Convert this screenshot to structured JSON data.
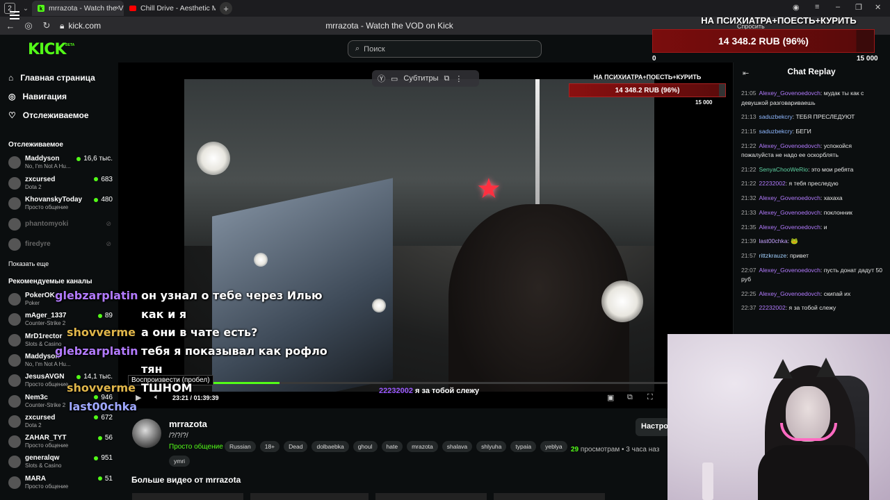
{
  "browser": {
    "tab_count": "2",
    "tabs": [
      {
        "label": "mrrazota - Watch the V",
        "close": "×"
      },
      {
        "label": "Chill Drive - Aesthetic Mus"
      }
    ],
    "new_tab": "+",
    "url": "kick.com",
    "page_title": "mrrazota - Watch the VOD on Kick",
    "window_controls": {
      "minimize": "–",
      "restore": "❐",
      "close": "✕"
    }
  },
  "kick": {
    "logo": "KICK",
    "beta": "BETA",
    "search_placeholder": "Поиск"
  },
  "sidebar": {
    "menu": [
      {
        "label": "Главная страница",
        "icon": "home-icon"
      },
      {
        "label": "Навигация",
        "icon": "compass-icon"
      },
      {
        "label": "Отслеживаемое",
        "icon": "heart-icon"
      }
    ],
    "followed_heading": "Отслеживаемое",
    "followed": [
      {
        "name": "Maddyson",
        "category": "No, I'm Not A Hu...",
        "viewers": "16,6 тыс."
      },
      {
        "name": "zxcursed",
        "category": "Dota 2",
        "viewers": "683"
      },
      {
        "name": "KhovanskyToday",
        "category": "Просто общение",
        "viewers": "480"
      },
      {
        "name": "phantomyoki",
        "offline": true
      },
      {
        "name": "firedyre",
        "offline": true
      }
    ],
    "show_more": "Показать еще",
    "recommended_heading": "Рекомендуемые каналы",
    "recommended": [
      {
        "name": "PokerOK",
        "category": "Poker",
        "viewers": ""
      },
      {
        "name": "mAger_1337",
        "category": "Counter-Strike 2",
        "viewers": "89"
      },
      {
        "name": "MrD1rector",
        "category": "Slots & Casino",
        "viewers": ""
      },
      {
        "name": "Maddyson",
        "category": "No, I'm Not A Hu...",
        "viewers": ""
      },
      {
        "name": "JesusAVGN",
        "category": "Просто общение",
        "viewers": "14,1 тыс."
      },
      {
        "name": "Nem3c",
        "category": "Counter-Strike 2",
        "viewers": "946"
      },
      {
        "name": "zxcursed",
        "category": "Dota 2",
        "viewers": "672"
      },
      {
        "name": "ZAHAR_TYT",
        "category": "Просто общение",
        "viewers": "56"
      },
      {
        "name": "generalqw",
        "category": "Slots & Casino",
        "viewers": "951"
      },
      {
        "name": "MARA",
        "category": "Просто общение",
        "viewers": "51"
      }
    ]
  },
  "player": {
    "subtitles_label": "Субтитры",
    "overlay_title": "НА ПСИХИАТРА+ПОЕСТЬ+КУРИТЬ",
    "overlay_amount": "14 348.2 RUB (96%)",
    "overlay_max": "15 000",
    "progress": 0.28,
    "tooltip": "Воспроизвести (пробел)",
    "time": "23:21 / 01:39:39",
    "chat_user": "22232002",
    "chat_msg": "я за тобой слежу"
  },
  "stream_chat_overlay": [
    {
      "user": "glebzarplatin",
      "msg": "он узнал о тебе через Илью"
    },
    {
      "user": "",
      "msg": "как и я"
    },
    {
      "user": "shovverme",
      "msg": "а они в чате есть?"
    },
    {
      "user": "glebzarplatin",
      "msg": "тебя я показывал как рофло"
    },
    {
      "user": "",
      "msg": "тян"
    },
    {
      "user": "shovverme",
      "msg": "ТШНОМ"
    },
    {
      "user": "last00chka",
      "msg": ""
    }
  ],
  "info": {
    "streamer": "mrrazota",
    "title": "/?/?/?/",
    "category": "Просто общение",
    "tags": [
      "Russian",
      "18+",
      "Dead",
      "dolbaebka",
      "ghoul",
      "hate",
      "mrazota",
      "shalava",
      "shlyuha",
      "typaia",
      "yeblya",
      "ymri"
    ],
    "views_count": "29",
    "views_label": "просмотрам",
    "ago": "• 3 часа наз",
    "settings_btn": "Настро",
    "more_videos": "Больше видео от mrrazota"
  },
  "chat": {
    "title": "Chat Replay",
    "messages": [
      {
        "time": "21:05",
        "user": "Alexey_Govenoedovch",
        "color": "#b37bff",
        "text": "мудак ты как с девушкой разговариваешь"
      },
      {
        "time": "21:13",
        "user": "saduzbekcry",
        "color": "#8fb8ff",
        "text": "ТЕБЯ ПРЕСЛЕДУЮТ"
      },
      {
        "time": "21:15",
        "user": "saduzbekcry",
        "color": "#8fb8ff",
        "text": "БЕГИ"
      },
      {
        "time": "21:22",
        "user": "Alexey_Govenoedovch",
        "color": "#b37bff",
        "text": "успокойся пожалуйста не надо ее оскорблять"
      },
      {
        "time": "21:22",
        "user": "SenyaChooWeRio",
        "color": "#5fd3a3",
        "text": "это мои ребята"
      },
      {
        "time": "21:22",
        "user": "22232002",
        "color": "#b37bff",
        "text": "я тебя преследую"
      },
      {
        "time": "21:32",
        "user": "Alexey_Govenoedovch",
        "color": "#b37bff",
        "text": "хахаха"
      },
      {
        "time": "21:33",
        "user": "Alexey_Govenoedovch",
        "color": "#b37bff",
        "text": "поклонник"
      },
      {
        "time": "21:35",
        "user": "Alexey_Govenoedovch",
        "color": "#b37bff",
        "text": "и"
      },
      {
        "time": "21:39",
        "user": "last00chka",
        "color": "#c6a2ff",
        "text": "🐸"
      },
      {
        "time": "21:57",
        "user": "rittzkrauze",
        "color": "#a3d1ff",
        "text": "привет"
      },
      {
        "time": "22:07",
        "user": "Alexey_Govenoedovch",
        "color": "#b37bff",
        "text": "пусть донат дадут 50 руб"
      },
      {
        "time": "22:25",
        "user": "Alexey_Govenoedovch",
        "color": "#b37bff",
        "text": "скипай их"
      },
      {
        "time": "22:37",
        "user": "22232002",
        "color": "#b37bff",
        "text": "я за тобой слежу"
      }
    ]
  },
  "stream_overlay": {
    "title": "НА ПСИХИАТРА+ПОЕСТЬ+КУРИТЬ",
    "amount": "14 348.2 RUB (96%)",
    "min": "0",
    "max": "15 000",
    "ask_label": "Спросить"
  }
}
